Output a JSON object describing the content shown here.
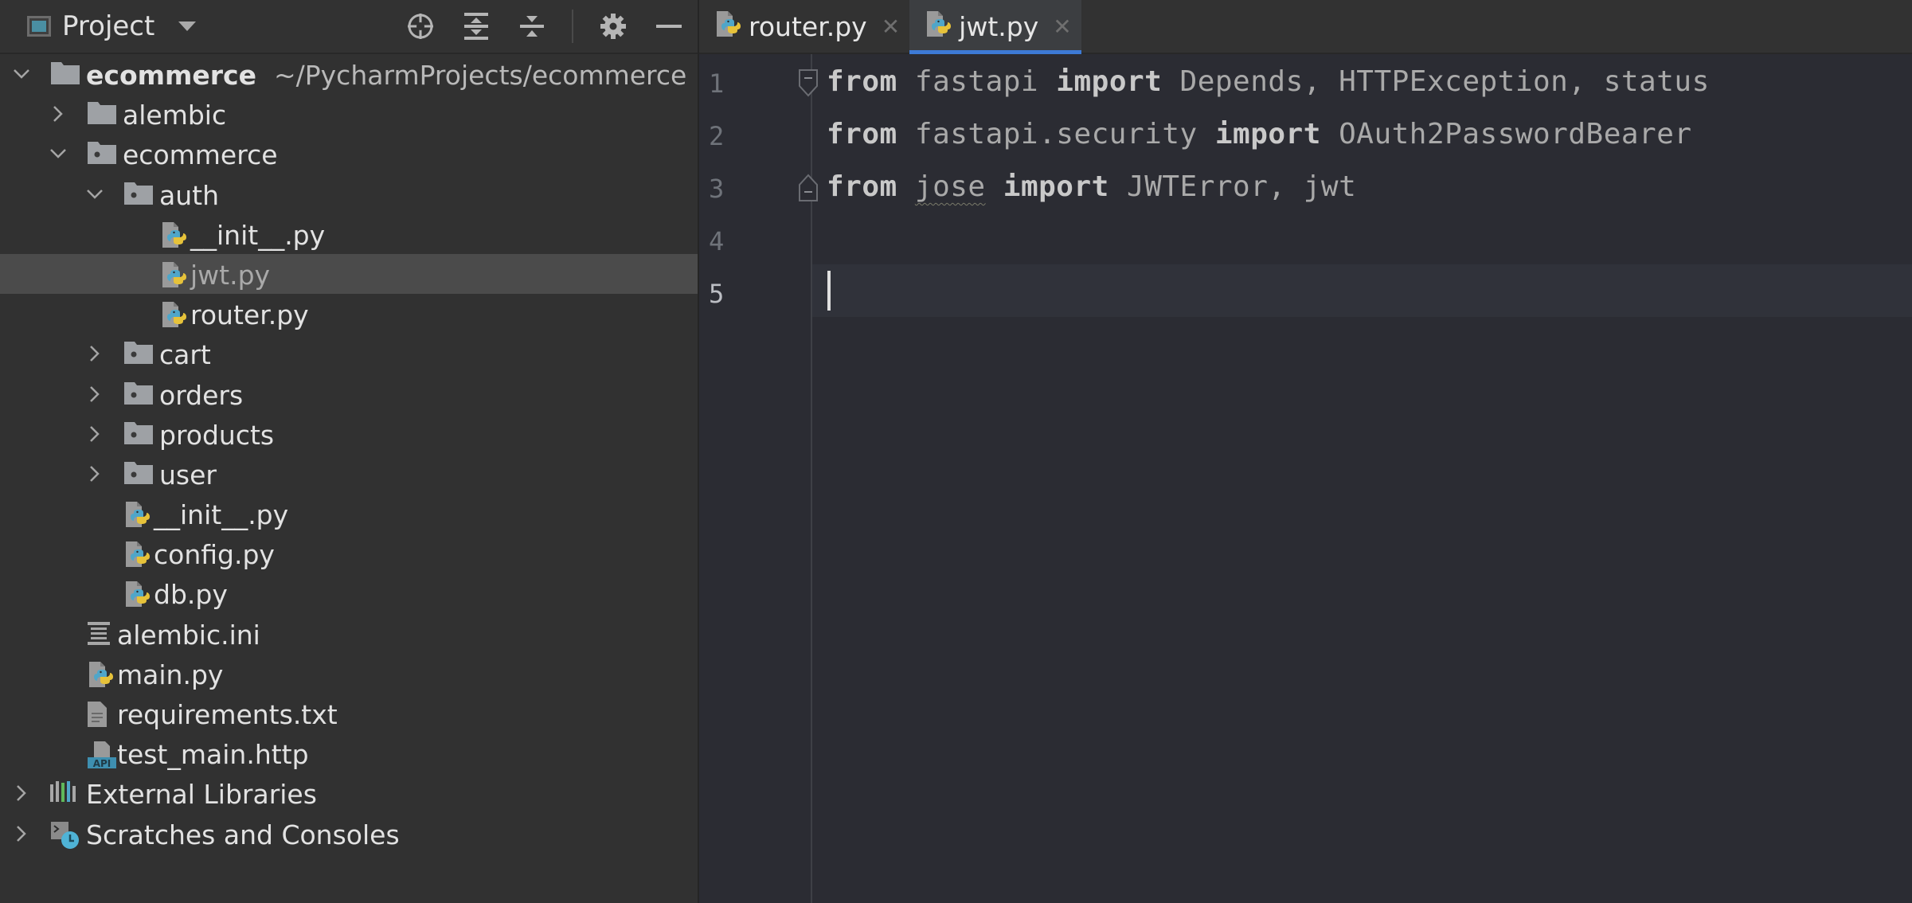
{
  "sidebar": {
    "title": "Project",
    "toolbar": [
      "locate-icon",
      "expand-all-icon",
      "collapse-all-icon",
      "gear-icon",
      "minimize-icon"
    ],
    "tree": [
      {
        "label": "ecommerce",
        "path": "~/PycharmProjects/ecommerce",
        "kind": "root-folder",
        "depth": 0,
        "expanded": true
      },
      {
        "label": "alembic",
        "kind": "folder",
        "depth": 1,
        "expanded": false
      },
      {
        "label": "ecommerce",
        "kind": "package",
        "depth": 1,
        "expanded": true
      },
      {
        "label": "auth",
        "kind": "package",
        "depth": 2,
        "expanded": true
      },
      {
        "label": "__init__.py",
        "kind": "python",
        "depth": 3
      },
      {
        "label": "jwt.py",
        "kind": "python",
        "depth": 3,
        "selected": true
      },
      {
        "label": "router.py",
        "kind": "python",
        "depth": 3
      },
      {
        "label": "cart",
        "kind": "package",
        "depth": 2,
        "expanded": false
      },
      {
        "label": "orders",
        "kind": "package",
        "depth": 2,
        "expanded": false
      },
      {
        "label": "products",
        "kind": "package",
        "depth": 2,
        "expanded": false
      },
      {
        "label": "user",
        "kind": "package",
        "depth": 2,
        "expanded": false
      },
      {
        "label": "__init__.py",
        "kind": "python",
        "depth": 2
      },
      {
        "label": "config.py",
        "kind": "python",
        "depth": 2
      },
      {
        "label": "db.py",
        "kind": "python",
        "depth": 2
      },
      {
        "label": "alembic.ini",
        "kind": "ini",
        "depth": 1
      },
      {
        "label": "main.py",
        "kind": "python",
        "depth": 1
      },
      {
        "label": "requirements.txt",
        "kind": "text",
        "depth": 1
      },
      {
        "label": "test_main.http",
        "kind": "http",
        "depth": 1
      },
      {
        "label": "External Libraries",
        "kind": "libraries",
        "depth": 0,
        "expanded": false
      },
      {
        "label": "Scratches and Consoles",
        "kind": "scratches",
        "depth": 0,
        "expanded": false
      }
    ]
  },
  "editor": {
    "tabs": [
      {
        "label": "router.py",
        "active": false
      },
      {
        "label": "jwt.py",
        "active": true
      }
    ],
    "lines": [
      {
        "num": "1",
        "tokens": [
          [
            "kw",
            "from"
          ],
          [
            "sp",
            " "
          ],
          [
            "mod",
            "fastapi"
          ],
          [
            "sp",
            " "
          ],
          [
            "kw",
            "import"
          ],
          [
            "sp",
            " "
          ],
          [
            "nm",
            "Depends, HTTPException, status"
          ]
        ]
      },
      {
        "num": "2",
        "tokens": [
          [
            "kw",
            "from"
          ],
          [
            "sp",
            " "
          ],
          [
            "mod",
            "fastapi.security"
          ],
          [
            "sp",
            " "
          ],
          [
            "kw",
            "import"
          ],
          [
            "sp",
            " "
          ],
          [
            "nm",
            "OAuth2PasswordBearer"
          ]
        ]
      },
      {
        "num": "3",
        "tokens": [
          [
            "kw",
            "from"
          ],
          [
            "sp",
            " "
          ],
          [
            "squiggle",
            "jose"
          ],
          [
            "sp",
            " "
          ],
          [
            "kw",
            "import"
          ],
          [
            "sp",
            " "
          ],
          [
            "nm",
            "JWTError, jwt"
          ]
        ]
      },
      {
        "num": "4",
        "tokens": []
      },
      {
        "num": "5",
        "tokens": []
      }
    ],
    "current_line": "5"
  },
  "colors": {
    "accent": "#3d7ad6",
    "python_blue": "#4fa6c9",
    "python_yellow": "#e6c23a"
  }
}
